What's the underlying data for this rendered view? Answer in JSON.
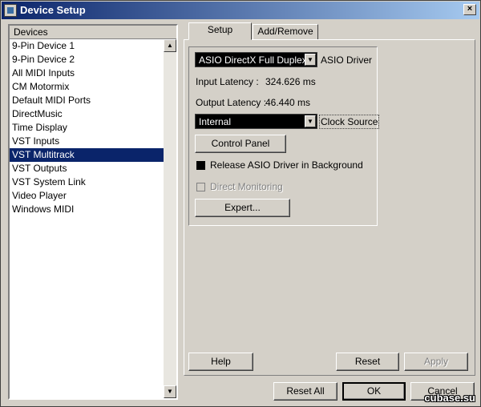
{
  "window": {
    "title": "Device Setup",
    "close_glyph": "×"
  },
  "devices": {
    "header": "Devices",
    "items": [
      "9-Pin Device 1",
      "9-Pin Device 2",
      "All MIDI Inputs",
      "CM Motormix",
      "Default MIDI Ports",
      "DirectMusic",
      "Time Display",
      "VST Inputs",
      "VST Multitrack",
      "VST Outputs",
      "VST System Link",
      "Video Player",
      "Windows MIDI"
    ],
    "selected": "VST Multitrack"
  },
  "tabs": {
    "setup": "Setup",
    "add_remove": "Add/Remove"
  },
  "setup": {
    "asio_driver_value": "ASIO DirectX Full Duplex Dri",
    "asio_driver_label": "ASIO Driver",
    "input_latency_label": "Input Latency :",
    "input_latency_value": "324.626 ms",
    "output_latency_label": "Output Latency :",
    "output_latency_value": "46.440 ms",
    "clock_source_value": "Internal",
    "clock_source_label": "Clock Source",
    "control_panel_label": "Control Panel",
    "release_asio_label": "Release ASIO Driver in Background",
    "release_asio_checked": true,
    "direct_monitoring_label": "Direct Monitoring",
    "direct_monitoring_enabled": false,
    "expert_label": "Expert..."
  },
  "buttons": {
    "help": "Help",
    "reset": "Reset",
    "apply": "Apply",
    "reset_all": "Reset All",
    "ok": "OK",
    "cancel": "Cancel"
  },
  "icons": {
    "scroll_up": "▲",
    "scroll_down": "▼",
    "dropdown": "▼"
  },
  "watermark": "cubase.su"
}
